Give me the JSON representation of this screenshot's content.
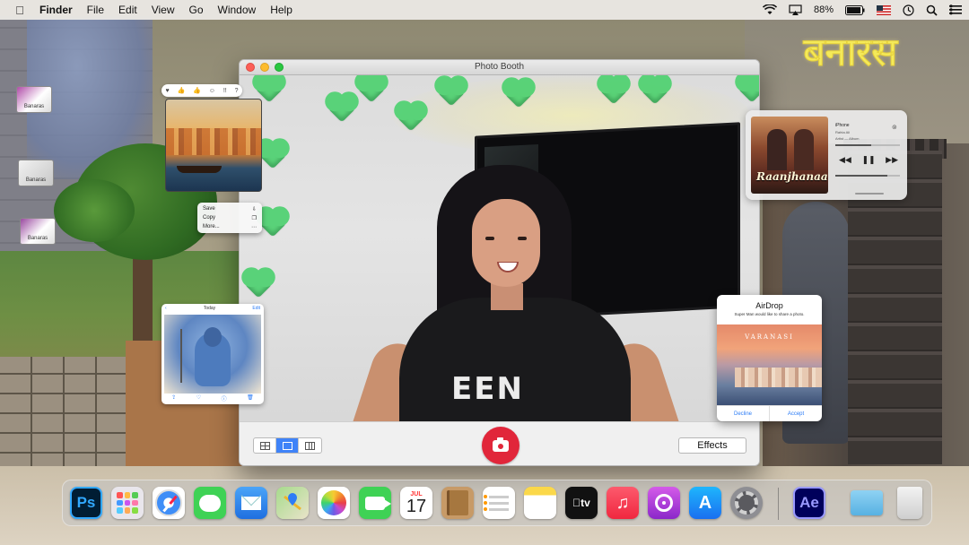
{
  "menubar": {
    "app_name": "Finder",
    "items": [
      "File",
      "Edit",
      "View",
      "Go",
      "Window",
      "Help"
    ],
    "battery": "88%"
  },
  "wallpaper": {
    "logo_text": "बनारस",
    "sign_text": "Banaras"
  },
  "photo_booth": {
    "title": "Photo Booth",
    "shirt_text": "EEN",
    "effects_label": "Effects",
    "view_modes": [
      "grid-view",
      "single-view",
      "filmstrip-view"
    ],
    "active_view": "single-view",
    "shutter_color": "#e1263a"
  },
  "photo_widget": {
    "menu_items": [
      {
        "label": "Save",
        "icon": "save-icon"
      },
      {
        "label": "Copy",
        "icon": "copy-icon"
      },
      {
        "label": "More...",
        "icon": "more-icon"
      }
    ]
  },
  "shiva_widget": {
    "back_label": "‹",
    "title": "Today",
    "edit_label": "Edit"
  },
  "music_widget": {
    "device": "iPhone",
    "song": "Rahta Ali",
    "artist": "Artist — Album",
    "album_title": "Raanjhanaa",
    "progress": 0.55,
    "volume": 0.8
  },
  "airdrop": {
    "title": "AirDrop",
    "message": "Super Man would like to share a photo.",
    "image_caption": "VARANASI",
    "decline_label": "Decline",
    "accept_label": "Accept"
  },
  "calendar": {
    "month": "JUL",
    "day": "17"
  },
  "dock": {
    "ps_label": "Ps",
    "tv_label": "tv",
    "ae_label": "Ae",
    "apps": [
      "Photoshop",
      "Launchpad",
      "Safari",
      "Messages",
      "Mail",
      "Maps",
      "Photos",
      "FaceTime",
      "Calendar",
      "Contacts",
      "Reminders",
      "Notes",
      "TV",
      "Music",
      "Podcasts",
      "App Store",
      "System Preferences",
      "After Effects",
      "Downloads",
      "Trash"
    ]
  }
}
